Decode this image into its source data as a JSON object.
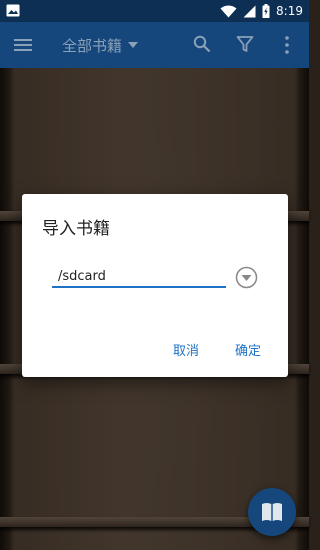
{
  "status_bar": {
    "time": "8:19",
    "icons": [
      "image-icon",
      "wifi-icon",
      "signal-icon",
      "battery-charging-icon"
    ]
  },
  "app_bar": {
    "title": "全部书籍",
    "icons": [
      "menu-icon",
      "dropdown-arrow-icon",
      "search-icon",
      "filter-icon",
      "more-vert-icon"
    ]
  },
  "dialog": {
    "title": "导入书籍",
    "path_value": "/sdcard",
    "cancel_label": "取消",
    "ok_label": "确定"
  },
  "fab": {
    "icon": "book-icon"
  },
  "colors": {
    "status_bar": "#0d2f53",
    "app_bar": "#15477c",
    "accent": "#1e73c6",
    "dialog_bg": "#ffffff",
    "shelf_wood": "#56473a"
  }
}
